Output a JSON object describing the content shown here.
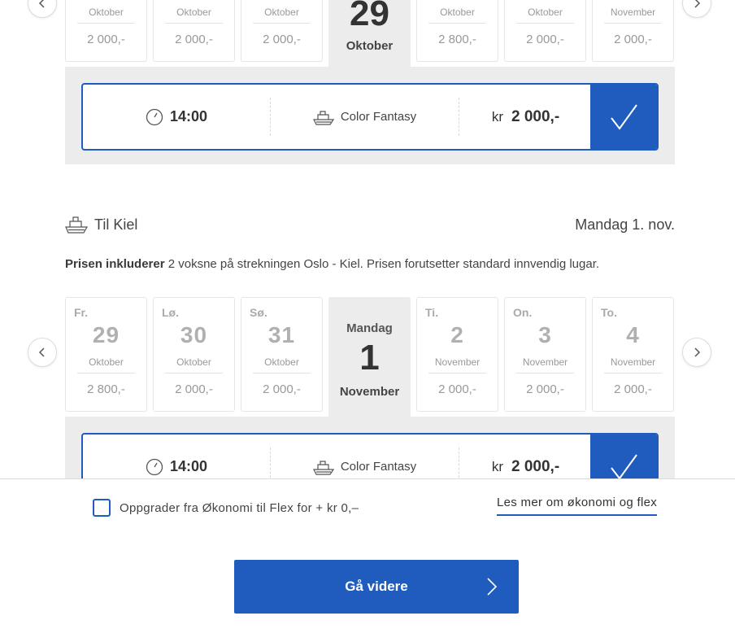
{
  "top_strip": {
    "cards": [
      {
        "month": "Oktober",
        "price": "2 000,-"
      },
      {
        "month": "Oktober",
        "price": "2 000,-"
      },
      {
        "month": "Oktober",
        "price": "2 000,-"
      },
      {
        "month": "Oktober",
        "price": "2 800,-"
      },
      {
        "month": "Oktober",
        "price": "2 000,-"
      },
      {
        "month": "November",
        "price": "2 000,-"
      }
    ],
    "selected": {
      "day": "29",
      "month": "Oktober"
    },
    "trip": {
      "time": "14:00",
      "ship": "Color Fantasy",
      "currency": "kr",
      "price": "2 000,-"
    }
  },
  "return_section": {
    "destination": "Til Kiel",
    "date": "Mandag 1. nov.",
    "includes_bold": "Prisen inkluderer",
    "includes_text": " 2 voksne på strekningen Oslo - Kiel. Prisen forutsetter standard innvendig lugar.",
    "cards": [
      {
        "dow": "Fr.",
        "day": "29",
        "month": "Oktober",
        "price": "2 800,-"
      },
      {
        "dow": "Lø.",
        "day": "30",
        "month": "Oktober",
        "price": "2 000,-"
      },
      {
        "dow": "Sø.",
        "day": "31",
        "month": "Oktober",
        "price": "2 000,-"
      },
      {
        "dow": "Ti.",
        "day": "2",
        "month": "November",
        "price": "2 000,-"
      },
      {
        "dow": "On.",
        "day": "3",
        "month": "November",
        "price": "2 000,-"
      },
      {
        "dow": "To.",
        "day": "4",
        "month": "November",
        "price": "2 000,-"
      }
    ],
    "selected": {
      "dow": "Mandag",
      "day": "1",
      "month": "November"
    },
    "trip": {
      "time": "14:00",
      "ship": "Color Fantasy",
      "currency": "kr",
      "price": "2 000,-"
    }
  },
  "footer": {
    "upgrade_label": "Oppgrader fra Økonomi til Flex for + kr 0,–",
    "read_more": "Les mer om økonomi og flex",
    "continue_label": "Gå videre"
  },
  "icons": {
    "clock": "clock-icon",
    "ship": "ship-icon",
    "check": "checkmark-icon",
    "prev": "chevron-left-icon",
    "next": "chevron-right-icon"
  },
  "colors": {
    "accent": "#1f5cbd",
    "panel": "#ececec"
  }
}
